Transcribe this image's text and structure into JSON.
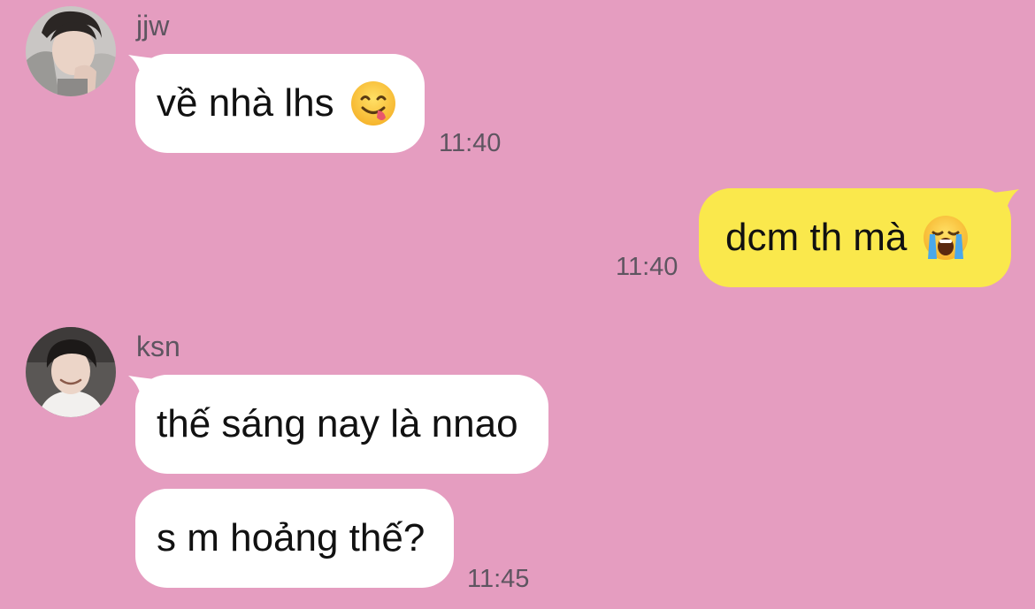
{
  "messages": [
    {
      "sender": "jjw",
      "text": "về nhà lhs",
      "emoji": "face-savoring-food-emoji",
      "time": "11:40",
      "direction": "incoming"
    },
    {
      "text": "dcm th mà",
      "emoji": "loudly-crying-face-emoji",
      "time": "11:40",
      "direction": "outgoing"
    },
    {
      "sender": "ksn",
      "text": "thế sáng nay là nnao",
      "direction": "incoming"
    },
    {
      "text": "s m hoảng thế?",
      "time": "11:45",
      "direction": "incoming"
    }
  ],
  "colors": {
    "background": "#e59dc0",
    "incoming_bubble": "#ffffff",
    "outgoing_bubble": "#fae84c",
    "meta_text": "#5e5560"
  }
}
